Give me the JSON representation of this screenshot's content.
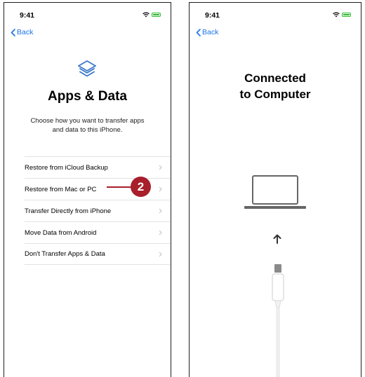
{
  "left_screen": {
    "status_time": "9:41",
    "back_label": "Back",
    "title": "Apps & Data",
    "subtitle_line1": "Choose how you want to transfer apps",
    "subtitle_line2": "and data to this iPhone.",
    "options": [
      {
        "label": "Restore from iCloud Backup"
      },
      {
        "label": "Restore from Mac or PC"
      },
      {
        "label": "Transfer Directly from iPhone"
      },
      {
        "label": "Move Data from Android"
      },
      {
        "label": "Don't Transfer Apps & Data"
      }
    ],
    "callout_number": "2"
  },
  "right_screen": {
    "status_time": "9:41",
    "back_label": "Back",
    "title_line1": "Connected",
    "title_line2": "to Computer"
  },
  "colors": {
    "accent": "#1a73e8",
    "callout": "#a81e2b",
    "battery": "#2db82d"
  },
  "icons": [
    "wifi-icon",
    "battery-icon",
    "chevron-left-icon",
    "layers-icon",
    "chevron-right-icon",
    "laptop-icon",
    "arrow-up-icon",
    "cable-icon"
  ]
}
